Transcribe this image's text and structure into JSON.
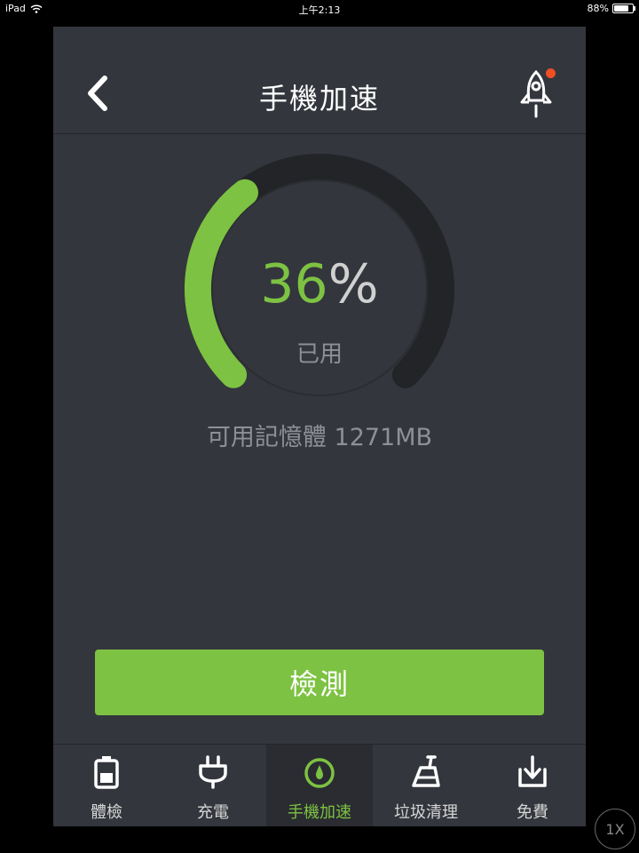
{
  "status_bar": {
    "device": "iPad",
    "time": "上午2:13",
    "battery_text": "88%",
    "battery_level": 0.88
  },
  "header": {
    "title": "手機加速",
    "back_icon": "chevron-left-icon",
    "rocket_icon": "rocket-icon",
    "notification_color": "#f04e23"
  },
  "gauge": {
    "percent_value": "36",
    "percent_symbol": "%",
    "used_fraction": 0.36,
    "label": "已用",
    "accent_color": "#7dc242"
  },
  "memory": {
    "text": "可用記憶體 1271MB"
  },
  "action": {
    "label": "檢測"
  },
  "tabs": [
    {
      "label": "體檢",
      "icon": "battery-icon",
      "active": false
    },
    {
      "label": "充電",
      "icon": "plug-icon",
      "active": false
    },
    {
      "label": "手機加速",
      "icon": "speedometer-icon",
      "active": true
    },
    {
      "label": "垃圾清理",
      "icon": "broom-icon",
      "active": false
    },
    {
      "label": "免費",
      "icon": "download-icon",
      "active": false
    }
  ],
  "speed_badge": "1X"
}
